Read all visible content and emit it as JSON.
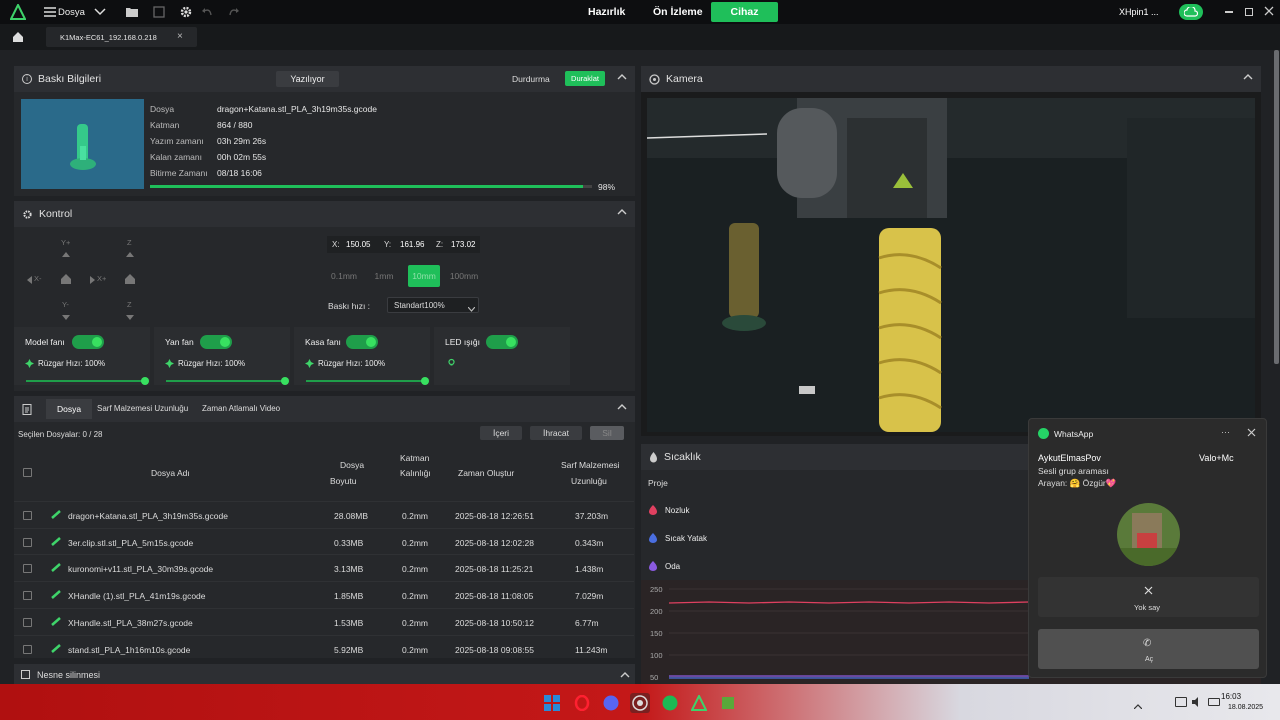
{
  "topbar": {
    "menu_label": "Dosya",
    "nav_prepare": "Hazırlık",
    "nav_preview": "Ön İzleme",
    "nav_device": "Cihaz",
    "user": "XHpin1 ..."
  },
  "tab": {
    "device_label": "K1Max-EC61_192.168.0.218",
    "close": "×"
  },
  "print_info": {
    "title": "Baskı Bilgileri",
    "status": "Yazılıyor",
    "stop": "Durdurma",
    "pause": "Duraklat",
    "labels": {
      "file": "Dosya",
      "layer": "Katman",
      "print_time": "Yazım zamanı",
      "remaining": "Kalan zamanı",
      "finish": "Bitirme Zamanı"
    },
    "values": {
      "file": "dragon+Katana.stl_PLA_3h19m35s.gcode",
      "layer": "864 / 880",
      "print_time": "03h 29m 26s",
      "remaining": "00h 02m 55s",
      "finish": "08/18 16:06"
    },
    "progress_label": "98%",
    "progress": 0.98
  },
  "control": {
    "title": "Kontrol",
    "jog": {
      "y_plus": "Y+",
      "y_minus": "Y-",
      "x_minus": "X-",
      "x_plus": "X+",
      "z_up": "Z",
      "z_down": "Z"
    },
    "coords": {
      "x_label": "X:",
      "x": "150.05",
      "y_label": "Y:",
      "y": "161.96",
      "z_label": "Z:",
      "z": "173.02"
    },
    "steps": [
      "0.1mm",
      "1mm",
      "10mm",
      "100mm"
    ],
    "speed_label": "Baskı hızı :",
    "speed_value": "Standart100%",
    "fans": [
      {
        "name": "Model fanı",
        "speed": "Rüzgar Hızı: 100%",
        "level": 1.0
      },
      {
        "name": "Yan fan",
        "speed": "Rüzgar Hızı: 100%",
        "level": 1.0
      },
      {
        "name": "Kasa fanı",
        "speed": "Rüzgar Hızı: 100%",
        "level": 1.0
      }
    ],
    "led": "LED ışığı"
  },
  "files": {
    "tabs": [
      "Dosya",
      "Sarf Malzemesi Uzunluğu",
      "Zaman Atlamalı Video"
    ],
    "selected": "Seçilen Dosyalar: 0 / 28",
    "import": "İçeri",
    "export": "İhracat",
    "delete": "Sil",
    "headers": {
      "name": "Dosya Adı",
      "size1": "Dosya",
      "size2": "Boyutu",
      "layer1": "Katman",
      "layer2": "Kalınlığı",
      "time": "Zaman Oluştur",
      "fil1": "Sarf Malzemesi",
      "fil2": "Uzunluğu"
    },
    "rows": [
      {
        "name": "dragon+Katana.stl_PLA_3h19m35s.gcode",
        "size": "28.08MB",
        "layer": "0.2mm",
        "time": "2025-08-18 12:26:51",
        "fil": "37.203m"
      },
      {
        "name": "3er.clip.stl.stl_PLA_5m15s.gcode",
        "size": "0.33MB",
        "layer": "0.2mm",
        "time": "2025-08-18 12:02:28",
        "fil": "0.343m"
      },
      {
        "name": "kuronomi+v11.stl_PLA_30m39s.gcode",
        "size": "3.13MB",
        "layer": "0.2mm",
        "time": "2025-08-18 11:25:21",
        "fil": "1.438m"
      },
      {
        "name": "XHandle (1).stl_PLA_41m19s.gcode",
        "size": "1.85MB",
        "layer": "0.2mm",
        "time": "2025-08-18 11:08:05",
        "fil": "7.029m"
      },
      {
        "name": "XHandle.stl_PLA_38m27s.gcode",
        "size": "1.53MB",
        "layer": "0.2mm",
        "time": "2025-08-18 10:50:12",
        "fil": "6.77m"
      },
      {
        "name": "stand.stl_PLA_1h16m10s.gcode",
        "size": "5.92MB",
        "layer": "0.2mm",
        "time": "2025-08-18 09:08:55",
        "fil": "11.243m"
      }
    ],
    "delete_object": "Nesne silinmesi"
  },
  "camera": {
    "title": "Kamera"
  },
  "temperature": {
    "title": "Sıcaklık",
    "col": "Proje",
    "nozzle": "Nozluk",
    "bed": "Sıcak Yatak",
    "chamber": "Oda",
    "ticks": [
      "250",
      "200",
      "150",
      "100",
      "50"
    ],
    "nozzle_color": "#e04060",
    "bed_color": "#4a6ee0",
    "chamber_color": "#8a5ae0"
  },
  "whatsapp": {
    "app": "WhatsApp",
    "caller": "AykutElmasPov",
    "group": "Valo+Mc",
    "line1": "Sesli grup araması",
    "line2": "Arayan: 🤗 Özgür💖",
    "decline": "Yok say",
    "accept": "Aç"
  },
  "taskbar": {
    "time": "16:03",
    "date": "18.08.2025"
  },
  "colors": {
    "accent": "#1fbf5a",
    "bg": "#202225"
  }
}
